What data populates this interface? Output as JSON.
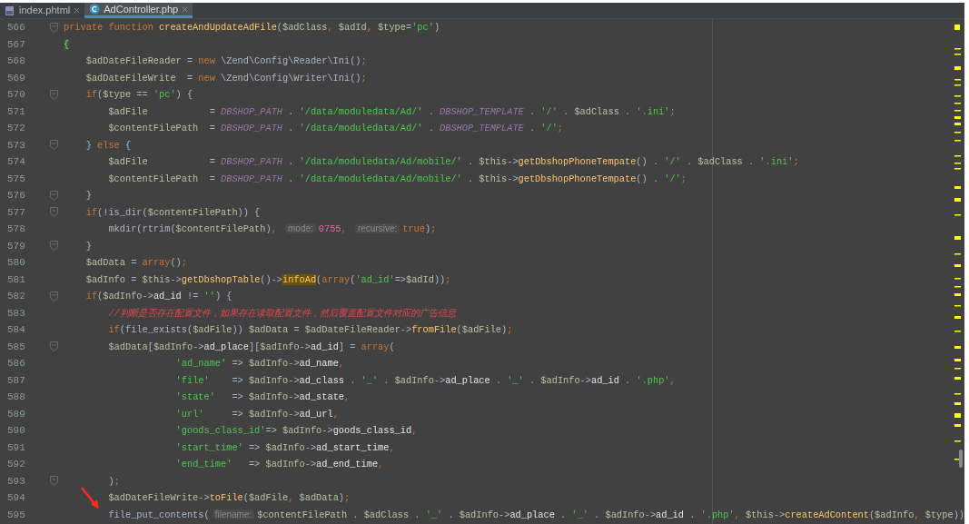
{
  "tabs": [
    {
      "label": "index.phtml",
      "kind": "html",
      "selected": false
    },
    {
      "label": "AdController.php",
      "kind": "class",
      "selected": true
    }
  ],
  "editor": {
    "lines": [
      {
        "number": "566",
        "fold": true,
        "tokens": [
          {
            "kind": "kw",
            "text": "private function "
          },
          {
            "kind": "fn",
            "text": "createAndUpdateAdFile"
          },
          {
            "kind": "plain",
            "text": "("
          },
          {
            "kind": "var",
            "text": "$adClass"
          },
          {
            "kind": "punct",
            "text": ", "
          },
          {
            "kind": "var",
            "text": "$adId"
          },
          {
            "kind": "punct",
            "text": ", "
          },
          {
            "kind": "var",
            "text": "$type"
          },
          {
            "kind": "plain",
            "text": "="
          },
          {
            "kind": "str",
            "text": "'pc'"
          },
          {
            "kind": "plain",
            "text": ")"
          }
        ]
      },
      {
        "number": "567",
        "fold": false,
        "tokens": [
          {
            "kind": "brace",
            "text": "{"
          }
        ]
      },
      {
        "number": "568",
        "fold": false,
        "tokens": [
          {
            "kind": "var",
            "text": "    $adDateFileReader"
          },
          {
            "kind": "plain",
            "text": " = "
          },
          {
            "kind": "kw",
            "text": "new"
          },
          {
            "kind": "plain",
            "text": " \\Zend\\Config\\Reader\\Ini()"
          },
          {
            "kind": "punct",
            "text": ";"
          }
        ]
      },
      {
        "number": "569",
        "fold": false,
        "tokens": [
          {
            "kind": "var",
            "text": "    $adDateFileWrite"
          },
          {
            "kind": "plain",
            "text": "  = "
          },
          {
            "kind": "kw",
            "text": "new"
          },
          {
            "kind": "plain",
            "text": " \\Zend\\Config\\Writer\\Ini()"
          },
          {
            "kind": "punct",
            "text": ";"
          }
        ]
      },
      {
        "number": "570",
        "fold": true,
        "tokens": [
          {
            "kind": "kw",
            "text": "    if"
          },
          {
            "kind": "plain",
            "text": "("
          },
          {
            "kind": "var",
            "text": "$type"
          },
          {
            "kind": "plain",
            "text": " == "
          },
          {
            "kind": "str",
            "text": "'pc'"
          },
          {
            "kind": "plain",
            "text": ") {"
          }
        ]
      },
      {
        "number": "571",
        "fold": false,
        "tokens": [
          {
            "kind": "var",
            "text": "        $adFile"
          },
          {
            "kind": "plain",
            "text": "           = "
          },
          {
            "kind": "const",
            "text": "DBSHOP_PATH"
          },
          {
            "kind": "plain",
            "text": " . "
          },
          {
            "kind": "str",
            "text": "'/data/moduledata/Ad/'"
          },
          {
            "kind": "plain",
            "text": " . "
          },
          {
            "kind": "const",
            "text": "DBSHOP_TEMPLATE"
          },
          {
            "kind": "plain",
            "text": " . "
          },
          {
            "kind": "str",
            "text": "'/'"
          },
          {
            "kind": "plain",
            "text": " . "
          },
          {
            "kind": "var",
            "text": "$adClass"
          },
          {
            "kind": "plain",
            "text": " . "
          },
          {
            "kind": "str",
            "text": "'.ini'"
          },
          {
            "kind": "punct",
            "text": ";"
          }
        ]
      },
      {
        "number": "572",
        "fold": false,
        "tokens": [
          {
            "kind": "var",
            "text": "        $contentFilePath"
          },
          {
            "kind": "plain",
            "text": "  = "
          },
          {
            "kind": "const",
            "text": "DBSHOP_PATH"
          },
          {
            "kind": "plain",
            "text": " . "
          },
          {
            "kind": "str",
            "text": "'/data/moduledata/Ad/'"
          },
          {
            "kind": "plain",
            "text": " . "
          },
          {
            "kind": "const",
            "text": "DBSHOP_TEMPLATE"
          },
          {
            "kind": "plain",
            "text": " . "
          },
          {
            "kind": "str",
            "text": "'/'"
          },
          {
            "kind": "punct",
            "text": ";"
          }
        ]
      },
      {
        "number": "573",
        "fold": true,
        "tokens": [
          {
            "kind": "plain",
            "text": "    } "
          },
          {
            "kind": "kw",
            "text": "else"
          },
          {
            "kind": "plain",
            "text": " {"
          }
        ]
      },
      {
        "number": "574",
        "fold": false,
        "tokens": [
          {
            "kind": "var",
            "text": "        $adFile"
          },
          {
            "kind": "plain",
            "text": "           = "
          },
          {
            "kind": "const",
            "text": "DBSHOP_PATH"
          },
          {
            "kind": "plain",
            "text": " . "
          },
          {
            "kind": "str",
            "text": "'/data/moduledata/Ad/mobile/'"
          },
          {
            "kind": "plain",
            "text": " . "
          },
          {
            "kind": "var",
            "text": "$this"
          },
          {
            "kind": "plain",
            "text": "->"
          },
          {
            "kind": "fn",
            "text": "getDbshopPhoneTempate"
          },
          {
            "kind": "plain",
            "text": "() . "
          },
          {
            "kind": "str",
            "text": "'/'"
          },
          {
            "kind": "plain",
            "text": " . "
          },
          {
            "kind": "var",
            "text": "$adClass"
          },
          {
            "kind": "plain",
            "text": " . "
          },
          {
            "kind": "str",
            "text": "'.ini'"
          },
          {
            "kind": "punct",
            "text": ";"
          }
        ]
      },
      {
        "number": "575",
        "fold": false,
        "tokens": [
          {
            "kind": "var",
            "text": "        $contentFilePath"
          },
          {
            "kind": "plain",
            "text": "  = "
          },
          {
            "kind": "const",
            "text": "DBSHOP_PATH"
          },
          {
            "kind": "plain",
            "text": " . "
          },
          {
            "kind": "str",
            "text": "'/data/moduledata/Ad/mobile/'"
          },
          {
            "kind": "plain",
            "text": " . "
          },
          {
            "kind": "var",
            "text": "$this"
          },
          {
            "kind": "plain",
            "text": "->"
          },
          {
            "kind": "fn",
            "text": "getDbshopPhoneTempate"
          },
          {
            "kind": "plain",
            "text": "() . "
          },
          {
            "kind": "str",
            "text": "'/'"
          },
          {
            "kind": "punct",
            "text": ";"
          }
        ]
      },
      {
        "number": "576",
        "fold": true,
        "tokens": [
          {
            "kind": "plain",
            "text": "    }"
          }
        ]
      },
      {
        "number": "577",
        "fold": true,
        "tokens": [
          {
            "kind": "kw",
            "text": "    if"
          },
          {
            "kind": "plain",
            "text": "(!is_dir("
          },
          {
            "kind": "var",
            "text": "$contentFilePath"
          },
          {
            "kind": "plain",
            "text": ")) {"
          }
        ]
      },
      {
        "number": "578",
        "fold": false,
        "tokens": [
          {
            "kind": "plain",
            "text": "        mkdir(rtrim("
          },
          {
            "kind": "var",
            "text": "$contentFilePath"
          },
          {
            "kind": "plain",
            "text": ")"
          },
          {
            "kind": "punct",
            "text": ", "
          },
          {
            "kind": "hint",
            "text": "mode:"
          },
          {
            "kind": "num",
            "text": "0755"
          },
          {
            "kind": "punct",
            "text": ", "
          },
          {
            "kind": "hint",
            "text": "recursive:"
          },
          {
            "kind": "kw",
            "text": "true"
          },
          {
            "kind": "plain",
            "text": ")"
          },
          {
            "kind": "punct",
            "text": ";"
          }
        ]
      },
      {
        "number": "579",
        "fold": true,
        "tokens": [
          {
            "kind": "plain",
            "text": "    }"
          }
        ]
      },
      {
        "number": "580",
        "fold": false,
        "tokens": [
          {
            "kind": "var",
            "text": "    $adData"
          },
          {
            "kind": "plain",
            "text": " = "
          },
          {
            "kind": "kw",
            "text": "array"
          },
          {
            "kind": "plain",
            "text": "()"
          },
          {
            "kind": "punct",
            "text": ";"
          }
        ]
      },
      {
        "number": "581",
        "fold": false,
        "tokens": [
          {
            "kind": "var",
            "text": "    $adInfo"
          },
          {
            "kind": "plain",
            "text": " = "
          },
          {
            "kind": "var",
            "text": "$this"
          },
          {
            "kind": "plain",
            "text": "->"
          },
          {
            "kind": "fn",
            "text": "getDbshopTable"
          },
          {
            "kind": "plain",
            "text": "()->"
          },
          {
            "kind": "fnmatch",
            "text": "infoAd"
          },
          {
            "kind": "plain",
            "text": "("
          },
          {
            "kind": "kw",
            "text": "array"
          },
          {
            "kind": "plain",
            "text": "("
          },
          {
            "kind": "str",
            "text": "'ad_id'"
          },
          {
            "kind": "plain",
            "text": "=>"
          },
          {
            "kind": "var",
            "text": "$adId"
          },
          {
            "kind": "plain",
            "text": "))"
          },
          {
            "kind": "punct",
            "text": ";"
          }
        ]
      },
      {
        "number": "582",
        "fold": true,
        "tokens": [
          {
            "kind": "kw",
            "text": "    if"
          },
          {
            "kind": "plain",
            "text": "("
          },
          {
            "kind": "var",
            "text": "$adInfo"
          },
          {
            "kind": "plain",
            "text": "->"
          },
          {
            "kind": "prop",
            "text": "ad_id"
          },
          {
            "kind": "plain",
            "text": " != "
          },
          {
            "kind": "str",
            "text": "''"
          },
          {
            "kind": "plain",
            "text": ") {"
          }
        ]
      },
      {
        "number": "583",
        "fold": false,
        "tokens": [
          {
            "kind": "comment",
            "text": "        //判断是否存在配置文件，如果存在读取配置文件，然后覆盖配置文件对应的广告信息"
          }
        ]
      },
      {
        "number": "584",
        "fold": false,
        "tokens": [
          {
            "kind": "kw",
            "text": "        if"
          },
          {
            "kind": "plain",
            "text": "(file_exists("
          },
          {
            "kind": "var",
            "text": "$adFile"
          },
          {
            "kind": "plain",
            "text": ")) "
          },
          {
            "kind": "var",
            "text": "$adData"
          },
          {
            "kind": "plain",
            "text": " = "
          },
          {
            "kind": "var",
            "text": "$adDateFileReader"
          },
          {
            "kind": "plain",
            "text": "->"
          },
          {
            "kind": "fn",
            "text": "fromFile"
          },
          {
            "kind": "plain",
            "text": "("
          },
          {
            "kind": "var",
            "text": "$adFile"
          },
          {
            "kind": "plain",
            "text": ")"
          },
          {
            "kind": "punct",
            "text": ";"
          }
        ]
      },
      {
        "number": "585",
        "fold": true,
        "tokens": [
          {
            "kind": "var",
            "text": "        $adData"
          },
          {
            "kind": "plain",
            "text": "["
          },
          {
            "kind": "var",
            "text": "$adInfo"
          },
          {
            "kind": "plain",
            "text": "->"
          },
          {
            "kind": "prop",
            "text": "ad_place"
          },
          {
            "kind": "plain",
            "text": "]["
          },
          {
            "kind": "var",
            "text": "$adInfo"
          },
          {
            "kind": "plain",
            "text": "->"
          },
          {
            "kind": "prop",
            "text": "ad_id"
          },
          {
            "kind": "plain",
            "text": "] = "
          },
          {
            "kind": "kw",
            "text": "array"
          },
          {
            "kind": "plain",
            "text": "("
          }
        ]
      },
      {
        "number": "586",
        "fold": false,
        "tokens": [
          {
            "kind": "str",
            "text": "                    'ad_name'"
          },
          {
            "kind": "plain",
            "text": " => "
          },
          {
            "kind": "var",
            "text": "$adInfo"
          },
          {
            "kind": "plain",
            "text": "->"
          },
          {
            "kind": "prop",
            "text": "ad_name"
          },
          {
            "kind": "punct",
            "text": ","
          }
        ]
      },
      {
        "number": "587",
        "fold": false,
        "tokens": [
          {
            "kind": "str",
            "text": "                    'file'"
          },
          {
            "kind": "plain",
            "text": "    => "
          },
          {
            "kind": "var",
            "text": "$adInfo"
          },
          {
            "kind": "plain",
            "text": "->"
          },
          {
            "kind": "prop",
            "text": "ad_class"
          },
          {
            "kind": "plain",
            "text": " . "
          },
          {
            "kind": "str",
            "text": "'_'"
          },
          {
            "kind": "plain",
            "text": " . "
          },
          {
            "kind": "var",
            "text": "$adInfo"
          },
          {
            "kind": "plain",
            "text": "->"
          },
          {
            "kind": "prop",
            "text": "ad_place"
          },
          {
            "kind": "plain",
            "text": " . "
          },
          {
            "kind": "str",
            "text": "'_'"
          },
          {
            "kind": "plain",
            "text": " . "
          },
          {
            "kind": "var",
            "text": "$adInfo"
          },
          {
            "kind": "plain",
            "text": "->"
          },
          {
            "kind": "prop",
            "text": "ad_id"
          },
          {
            "kind": "plain",
            "text": " . "
          },
          {
            "kind": "str",
            "text": "'.php'"
          },
          {
            "kind": "punct",
            "text": ","
          }
        ]
      },
      {
        "number": "588",
        "fold": false,
        "tokens": [
          {
            "kind": "str",
            "text": "                    'state'"
          },
          {
            "kind": "plain",
            "text": "   => "
          },
          {
            "kind": "var",
            "text": "$adInfo"
          },
          {
            "kind": "plain",
            "text": "->"
          },
          {
            "kind": "prop",
            "text": "ad_state"
          },
          {
            "kind": "punct",
            "text": ","
          }
        ]
      },
      {
        "number": "589",
        "fold": false,
        "tokens": [
          {
            "kind": "str",
            "text": "                    'url'"
          },
          {
            "kind": "plain",
            "text": "     => "
          },
          {
            "kind": "var",
            "text": "$adInfo"
          },
          {
            "kind": "plain",
            "text": "->"
          },
          {
            "kind": "prop",
            "text": "ad_url"
          },
          {
            "kind": "punct",
            "text": ","
          }
        ]
      },
      {
        "number": "590",
        "fold": false,
        "tokens": [
          {
            "kind": "str",
            "text": "                    'goods_class_id'"
          },
          {
            "kind": "plain",
            "text": "=> "
          },
          {
            "kind": "var",
            "text": "$adInfo"
          },
          {
            "kind": "plain",
            "text": "->"
          },
          {
            "kind": "prop",
            "text": "goods_class_id"
          },
          {
            "kind": "punct",
            "text": ","
          }
        ]
      },
      {
        "number": "591",
        "fold": false,
        "tokens": [
          {
            "kind": "str",
            "text": "                    'start_time'"
          },
          {
            "kind": "plain",
            "text": " => "
          },
          {
            "kind": "var",
            "text": "$adInfo"
          },
          {
            "kind": "plain",
            "text": "->"
          },
          {
            "kind": "prop",
            "text": "ad_start_time"
          },
          {
            "kind": "punct",
            "text": ","
          }
        ]
      },
      {
        "number": "592",
        "fold": false,
        "tokens": [
          {
            "kind": "str",
            "text": "                    'end_time'"
          },
          {
            "kind": "plain",
            "text": "   => "
          },
          {
            "kind": "var",
            "text": "$adInfo"
          },
          {
            "kind": "plain",
            "text": "->"
          },
          {
            "kind": "prop",
            "text": "ad_end_time"
          },
          {
            "kind": "punct",
            "text": ","
          }
        ]
      },
      {
        "number": "593",
        "fold": true,
        "tokens": [
          {
            "kind": "plain",
            "text": "        )"
          },
          {
            "kind": "punct",
            "text": ";"
          }
        ]
      },
      {
        "number": "594",
        "fold": false,
        "tokens": [
          {
            "kind": "var",
            "text": "        $adDateFileWrite"
          },
          {
            "kind": "plain",
            "text": "->"
          },
          {
            "kind": "fn",
            "text": "toFile"
          },
          {
            "kind": "plain",
            "text": "("
          },
          {
            "kind": "var",
            "text": "$adFile"
          },
          {
            "kind": "punct",
            "text": ", "
          },
          {
            "kind": "var",
            "text": "$adData"
          },
          {
            "kind": "plain",
            "text": ")"
          },
          {
            "kind": "punct",
            "text": ";"
          }
        ]
      },
      {
        "number": "595",
        "fold": false,
        "tokens": [
          {
            "kind": "plain",
            "text": "        file_put_contents("
          },
          {
            "kind": "hint",
            "text": "filename:"
          },
          {
            "kind": "var",
            "text": "$contentFilePath"
          },
          {
            "kind": "plain",
            "text": " . "
          },
          {
            "kind": "var",
            "text": "$adClass"
          },
          {
            "kind": "plain",
            "text": " . "
          },
          {
            "kind": "str",
            "text": "'_'"
          },
          {
            "kind": "plain",
            "text": " . "
          },
          {
            "kind": "var",
            "text": "$adInfo"
          },
          {
            "kind": "plain",
            "text": "->"
          },
          {
            "kind": "prop",
            "text": "ad_place"
          },
          {
            "kind": "plain",
            "text": " . "
          },
          {
            "kind": "str",
            "text": "'_'"
          },
          {
            "kind": "plain",
            "text": " . "
          },
          {
            "kind": "var",
            "text": "$adInfo"
          },
          {
            "kind": "plain",
            "text": "->"
          },
          {
            "kind": "prop",
            "text": "ad_id"
          },
          {
            "kind": "plain",
            "text": " . "
          },
          {
            "kind": "str",
            "text": "'.php'"
          },
          {
            "kind": "punct",
            "text": ", "
          },
          {
            "kind": "var",
            "text": "$this"
          },
          {
            "kind": "plain",
            "text": "->"
          },
          {
            "kind": "fn",
            "text": "createAdContent"
          },
          {
            "kind": "plain",
            "text": "("
          },
          {
            "kind": "var",
            "text": "$adInfo"
          },
          {
            "kind": "punct",
            "text": ", "
          },
          {
            "kind": "var",
            "text": "$type"
          },
          {
            "kind": "plain",
            "text": "))"
          }
        ]
      }
    ]
  }
}
